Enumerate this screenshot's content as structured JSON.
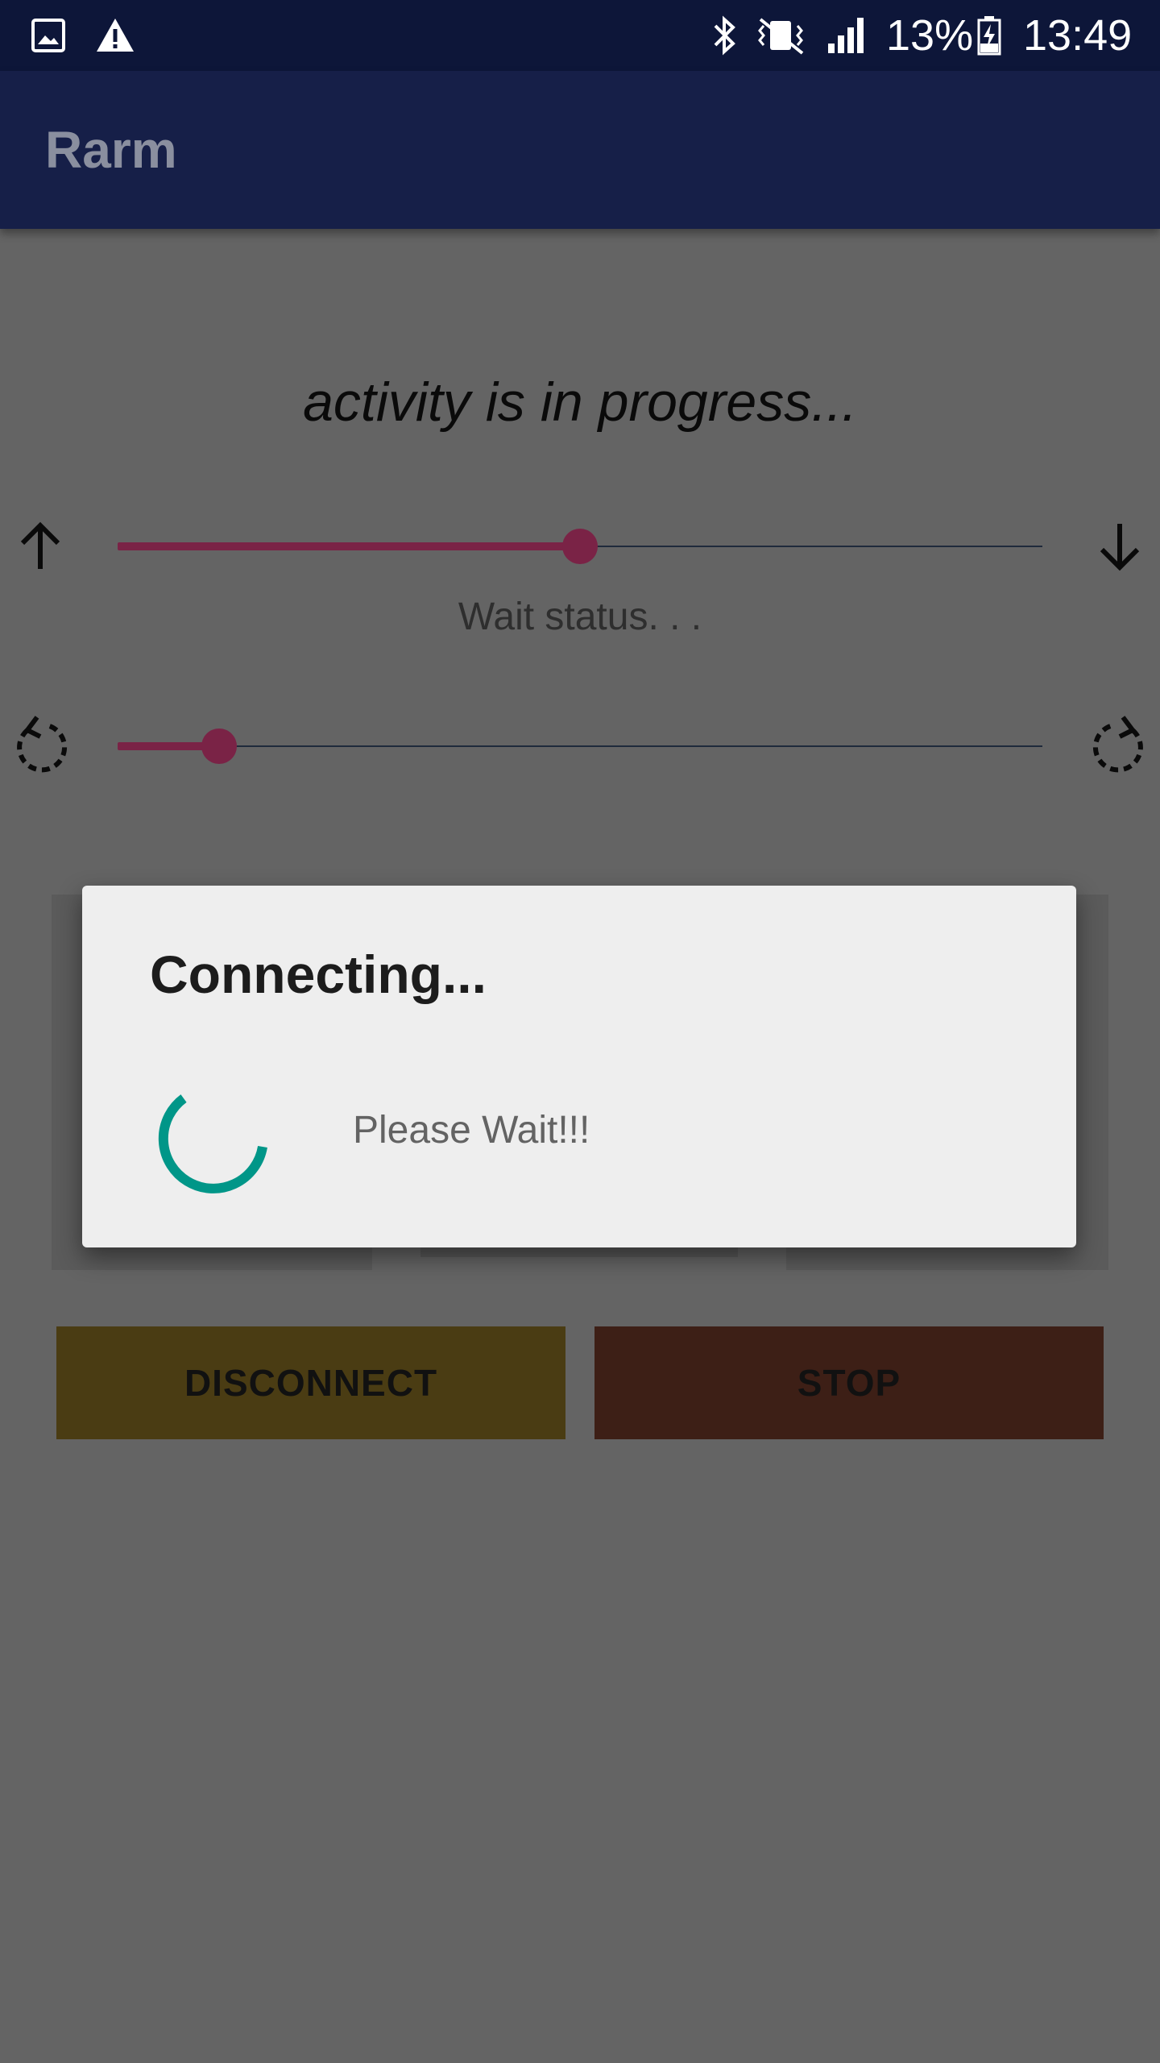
{
  "status_bar": {
    "battery": "13%",
    "time": "13:49",
    "icons": [
      "gallery-icon",
      "warning-icon",
      "bluetooth-icon",
      "vibrate-icon",
      "signal-icon",
      "battery-charging-icon"
    ]
  },
  "app_bar": {
    "title": "Rarm"
  },
  "main": {
    "activity_text": "activity is in progress...",
    "wait_status": "Wait status. . .",
    "vertical_slider": {
      "value_fraction": 0.5,
      "left_icon": "arrow-up-icon",
      "right_icon": "arrow-down-icon"
    },
    "rotation_slider": {
      "value_fraction": 0.11,
      "left_icon": "rotate-left-icon",
      "right_icon": "rotate-right-icon"
    },
    "buttons": {
      "disconnect": "DISCONNECT",
      "stop": "STOP"
    }
  },
  "dialog": {
    "title": "Connecting...",
    "message": "Please Wait!!!"
  },
  "colors": {
    "accent": "#7a2346",
    "spinner": "#009688",
    "app_bar": "#161f48",
    "disconnect_button": "#4a3c13",
    "stop_button": "#3d1f16"
  }
}
